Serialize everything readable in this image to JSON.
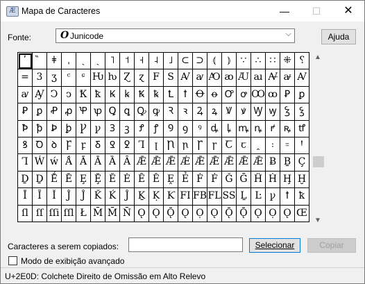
{
  "window": {
    "title": "Mapa de Caracteres",
    "icon": "character-map-icon",
    "controls": {
      "minimize": "—",
      "maximize": "☐",
      "close": "✕"
    }
  },
  "font": {
    "label": "Fonte:",
    "value": "Junicode",
    "icon_glyph": "O",
    "dropdown_arrow": "⌵"
  },
  "help_button": "Ajuda",
  "characters": [
    [
      "ʹ",
      "̏",
      "ǂ",
      "ˌ",
      "ˎ",
      "ˏ",
      "˥",
      "˦",
      "˧",
      "˨",
      "˩",
      "⊂",
      "⊃",
      "⦅",
      "⦆",
      "∵",
      "∴",
      "∷",
      "⁜",
      "⸮"
    ],
    [
      "=",
      "3",
      "ʒ",
      "ᶜ",
      "ᶝ",
      "Ƕ",
      "ƕ",
      "Ɀ",
      "ɀ",
      "F",
      "S",
      "Ꜹ",
      "ꜹ",
      "Ꜵ",
      "ꜵ",
      "Ꜷ",
      "ꜷ",
      "Ꜻ",
      "ꜻ",
      "Ꜹ"
    ],
    [
      "ꜹ",
      "Ꜽ",
      "Ↄ",
      "ↄ",
      "Ꝁ",
      "ꝁ",
      "Ꝃ",
      "ꝃ",
      "Ꝅ",
      "ꝅ",
      "Ꝉ",
      "ꝉ",
      "Ꝋ",
      "ꝋ",
      "Ꝍ",
      "ꝍ",
      "Ꝏ",
      "ꝏ",
      "Ꝑ",
      "ꝑ"
    ],
    [
      "Ꝑ",
      "ꝑ",
      "Ꝓ",
      "ꝓ",
      "Ꝕ",
      "ꝕ",
      "Ꝗ",
      "ꝗ",
      "Ꝙ",
      "ꝙ",
      "Ꝛ",
      "ꝛ",
      "Ꝝ",
      "ꝝ",
      "Ꝟ",
      "ꝟ",
      "Ꝡ",
      "ꝡ",
      "Ꝣ",
      "ꝣ"
    ],
    [
      "Ꝥ",
      "ꝥ",
      "Ꝧ",
      "ꝧ",
      "Ꝩ",
      "ꝩ",
      "Ꝫ",
      "ꝫ",
      "Ꝭ",
      "ꝭ",
      "Ꝯ",
      "ꝯ",
      "ꝰ",
      "ꝱ",
      "ꝲ",
      "ꝳ",
      "ꝴ",
      "ꝵ",
      "ꝶ",
      "ꝷ"
    ],
    [
      "ꝸ",
      "Ꝺ",
      "ꝺ",
      "Ꝼ",
      "ꝼ",
      "Ᵹ",
      "Ꝿ",
      "ꝿ",
      "Ꞁ",
      "ꞁ",
      "Ꞃ",
      "ꞃ",
      "Ꞅ",
      "ꞅ",
      "Ꞇ",
      "ꞇ",
      "ꞈ",
      "꞉",
      "꞊",
      "Ꞌ"
    ],
    [
      "Ꞁ",
      "Ẃ",
      "ẃ",
      "Ǻ",
      "Ā",
      "Ā",
      "Ȁ",
      "Ȃ",
      "Ǣ",
      "Ǣ",
      "Ǣ",
      "Ǽ",
      "Ǣ",
      "Ǣ",
      "Ǣ",
      "Ǣ",
      "Ǣ",
      "Ƀ",
      "Ḇ",
      "Ç"
    ],
    [
      "Ḏ",
      "Ḏ",
      "Ḗ",
      "Ē",
      "Ȩ",
      "Ḝ",
      "Ĕ",
      "Ė",
      "Ȇ",
      "Ê",
      "Ḙ",
      "Ẻ",
      "Ḟ",
      "Ḟ",
      "Ǧ",
      "Ḡ",
      "Ḧ",
      "Ḣ",
      "Ḩ",
      "Ḫ"
    ],
    [
      "Ī",
      "Ĩ",
      "Ǐ",
      "Ĵ",
      "Ĵ",
      "Ǩ",
      "Ḱ",
      "Ĵ",
      "Ḵ",
      "Ḳ",
      "Ƙ",
      "FI",
      "FB",
      "FL",
      "SS",
      "Ḻ",
      "Ŀ",
      "ꝩ",
      "ꝉ",
      "ꝁ"
    ],
    [
      "ſl",
      "ſſ",
      "ſſi",
      "ſſl",
      "Ł",
      "M̄",
      "M̄",
      "N̄",
      "Ǫ",
      "Ǫ",
      "Ǭ",
      "Ǫ",
      "Ọ",
      "Ǫ",
      "Ǭ",
      "Ǭ",
      "Ǫ",
      "Ọ",
      "Ǫ",
      "Œ"
    ]
  ],
  "copy": {
    "label": "Caracteres a serem copiados:",
    "value": "",
    "select_button": "Selecionar",
    "copy_button": "Copiar"
  },
  "advanced_view": {
    "label": "Modo de exibição avançado",
    "checked": false
  },
  "status": "U+2E0D: Colchete Direito de Omissão em Alto Relevo",
  "scroll": {
    "up": "▲",
    "down": "▼",
    "position_fraction": 0.6
  }
}
